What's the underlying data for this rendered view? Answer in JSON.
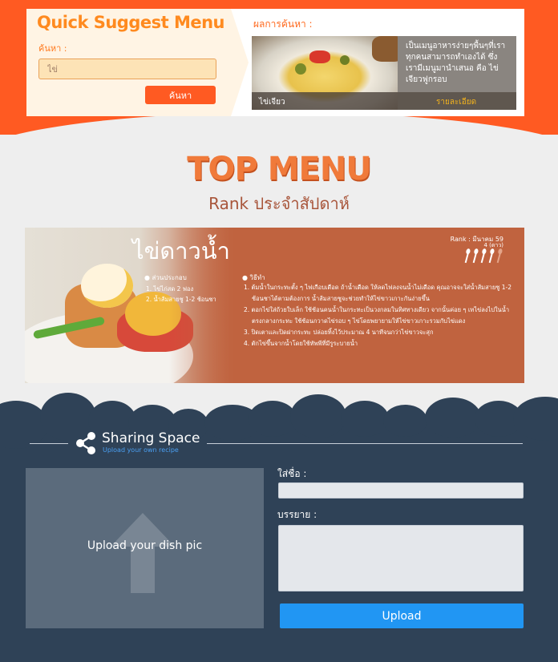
{
  "quick_suggest": {
    "title": "Quick Suggest Menu",
    "search_label": "ค้นหา :",
    "search_value": "ไข่",
    "search_button": "ค้นหา",
    "results_label": "ผลการค้นหา :",
    "result": {
      "description": "เป็นเมนูอาหารง่ายๆพื้นๆที่เราทุกคนสามารถทำเองได้ ซึ่งเรามีเมนูมานำเสนอ คือ ไข่เจียวฟูกรอบ",
      "dish_name": "ไข่เจียว",
      "detail_link": "รายละเอียด"
    }
  },
  "top_menu": {
    "title": "TOP MENU",
    "subtitle": "Rank ประจำสัปดาห์"
  },
  "featured": {
    "dish_name": "ไข่ดาวน้ำ",
    "rank_label": "Rank : มีนาคม 59",
    "rank_views": "4 (ดาว)",
    "rating": 4,
    "rating_max": 5,
    "ingredients_heading": "● ส่วนประกอบ",
    "ingredients": [
      "1. ไข่ไก่สด 2 ฟอง",
      "2. น้ำส้มสายชู 1-2 ช้อนชา"
    ],
    "method_heading": "● วิธีทำ",
    "method": [
      "1. ต้มน้ำในกระทะตั้ง ๆ ไฟเกือบเดือด ถ้าน้ำเดือด ให้ลดไฟลงจนน้ำไม่เดือด คุณอาจจะใส่น้ำส้มสายชู 1-2 ช้อนชาได้ตามต้องการ น้ำส้มสายชูจะช่วยทำให้ไข่ขาวเกาะกันง่ายขึ้น",
      "2. ตอกไข่ใส่ถ้วยใบเล็ก ใช้ช้อนคนน้ำในกระทะเป็นวงกลมในทิศทางเดียว จากนั้นค่อย ๆ เทไข่ลงไปในน้ำตรงกลางกระทะ ใช้ช้อนกวาดไข่รอบ ๆ ไข่โดยพยายามให้ไข่ขาวเกาะรวมกับไข่แดง",
      "3. ปิดเตาและปิดฝากระทะ ปล่อยทิ้งไว้ประมาณ 4 นาทีจนกว่าไข่ขาวจะสุก",
      "4. ตักไข่ขึ้นจากน้ำโดยใช้ทัพพีที่มีรูระบายน้ำ"
    ]
  },
  "sharing": {
    "title": "Sharing Space",
    "subtitle": "Upload your own recipe",
    "upload_prompt": "Upload your dish pic",
    "name_label": "ใส่ชื่อ :",
    "description_label": "บรรยาย :",
    "upload_button": "Upload"
  },
  "colors": {
    "brand_orange": "#ff5a22",
    "dark_navy": "#2f4257",
    "upload_blue": "#2196f3"
  }
}
